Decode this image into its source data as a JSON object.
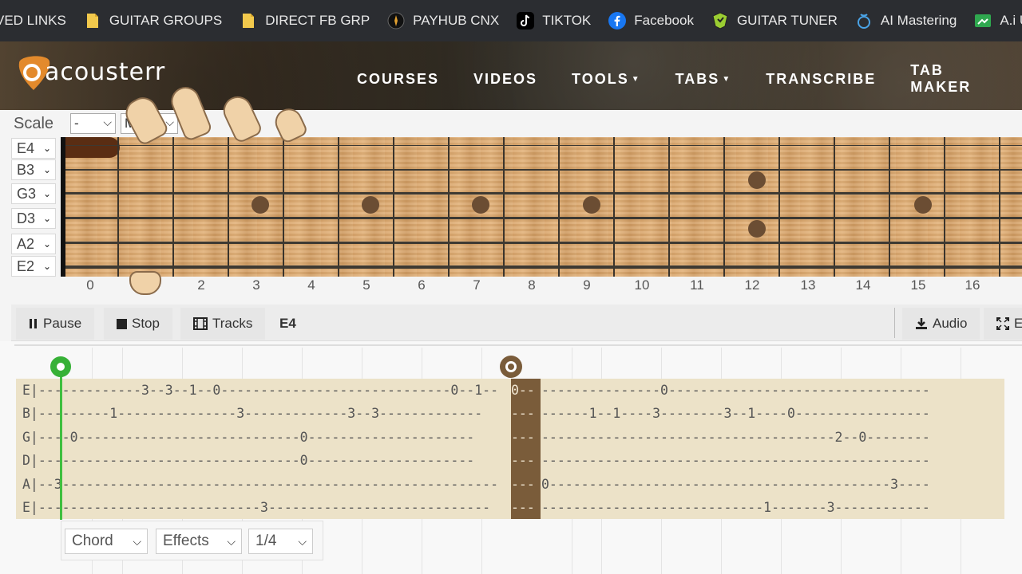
{
  "bookmarks": [
    {
      "label": "VED LINKS",
      "icon": "none"
    },
    {
      "label": "GUITAR GROUPS",
      "icon": "folder-icon"
    },
    {
      "label": "DIRECT FB GRP",
      "icon": "folder-icon"
    },
    {
      "label": "PAYHUB CNX",
      "icon": "payhub-icon"
    },
    {
      "label": "TIKTOK",
      "icon": "tiktok-icon"
    },
    {
      "label": "Facebook",
      "icon": "facebook-icon"
    },
    {
      "label": "GUITAR TUNER",
      "icon": "tuner-icon"
    },
    {
      "label": "AI Mastering",
      "icon": "mastering-icon"
    },
    {
      "label": "A.i Upsc",
      "icon": "upscale-icon"
    }
  ],
  "site": {
    "logo_text": "acousterr",
    "nav": [
      {
        "label": "COURSES",
        "dropdown": false
      },
      {
        "label": "VIDEOS",
        "dropdown": false
      },
      {
        "label": "TOOLS",
        "dropdown": true
      },
      {
        "label": "TABS",
        "dropdown": true
      },
      {
        "label": "TRANSCRIBE",
        "dropdown": false
      },
      {
        "label": "TAB MAKER",
        "dropdown": false
      }
    ]
  },
  "scale": {
    "label": "Scale",
    "key_value": "-",
    "mode_value": "M"
  },
  "strings": [
    "E4",
    "B3",
    "G3",
    "D3",
    "A2",
    "E2"
  ],
  "fret_numbers": [
    "0",
    "1",
    "2",
    "3",
    "4",
    "5",
    "6",
    "7",
    "8",
    "9",
    "10",
    "11",
    "12",
    "13",
    "14",
    "15",
    "16"
  ],
  "toolbar": {
    "pause_label": "Pause",
    "stop_label": "Stop",
    "tracks_label": "Tracks",
    "current_note": "E4",
    "audio_label": "Audio",
    "expand_label": "E"
  },
  "tab": {
    "lines_left": [
      "E|-------------3--3--1--0-----------------------------0--1--",
      "B|---------1---------------3-------------3--3-------------",
      "G|----0----------------------------0---------------------",
      "D|---------------------------------0---------------------",
      "A|--3-------------------------------------------------------",
      "E|----------------------------3----------------------------"
    ],
    "cursor_cells": [
      "0--",
      "---",
      "---",
      "---",
      "---",
      "---"
    ],
    "lines_right": [
      "---------------0---------------------------------",
      "------1--1----3--------3--1----0-----------------",
      "-------------------------------------2--0--------",
      "-------------------------------------------------",
      "0-------------------------------------------3----",
      "----------------------------1-------3------------"
    ]
  },
  "bottom": {
    "chord_label": "Chord",
    "effects_label": "Effects",
    "duration_label": "1/4"
  },
  "colors": {
    "bookmark_bar": "#2b2d31",
    "playhead": "#3fbf3f",
    "cursor": "#7a5c3a",
    "staff_bg": "#ece2c8",
    "played_note": "#5a2d13"
  }
}
